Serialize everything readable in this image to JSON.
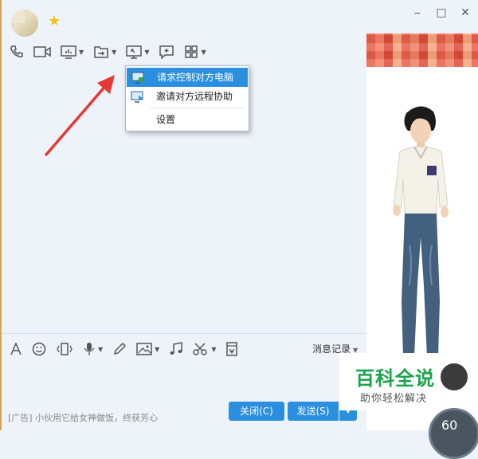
{
  "header": {
    "vip_icon": "star-icon"
  },
  "window_controls": {
    "minimize": "⎯",
    "maximize": "□",
    "close": "✕"
  },
  "toolbar": {
    "items": [
      "phone-icon",
      "video-icon",
      "screen-share-icon",
      "file-transfer-icon",
      "remote-desktop-icon",
      "add-app-icon",
      "apps-icon"
    ]
  },
  "context_menu": {
    "items": [
      {
        "label": "请求控制对方电脑",
        "selected": true
      },
      {
        "label": "邀请对方远程协助",
        "selected": false
      },
      {
        "label": "设置",
        "selected": false
      }
    ]
  },
  "input_toolbar": {
    "message_log_label": "消息记录"
  },
  "footer": {
    "ad_text": "[广告] 小伙用它给女神做饭，终获芳心",
    "close_label": "关闭(C)",
    "send_label": "发送(S)",
    "send_dropdown": "▼"
  },
  "watermark": {
    "title": "百科全说",
    "subtitle": "助你轻松解决",
    "dial_value": "60"
  },
  "colors": {
    "accent": "#2b8fe0",
    "arrow": "#e53935",
    "watermark_green": "#19a34a"
  }
}
